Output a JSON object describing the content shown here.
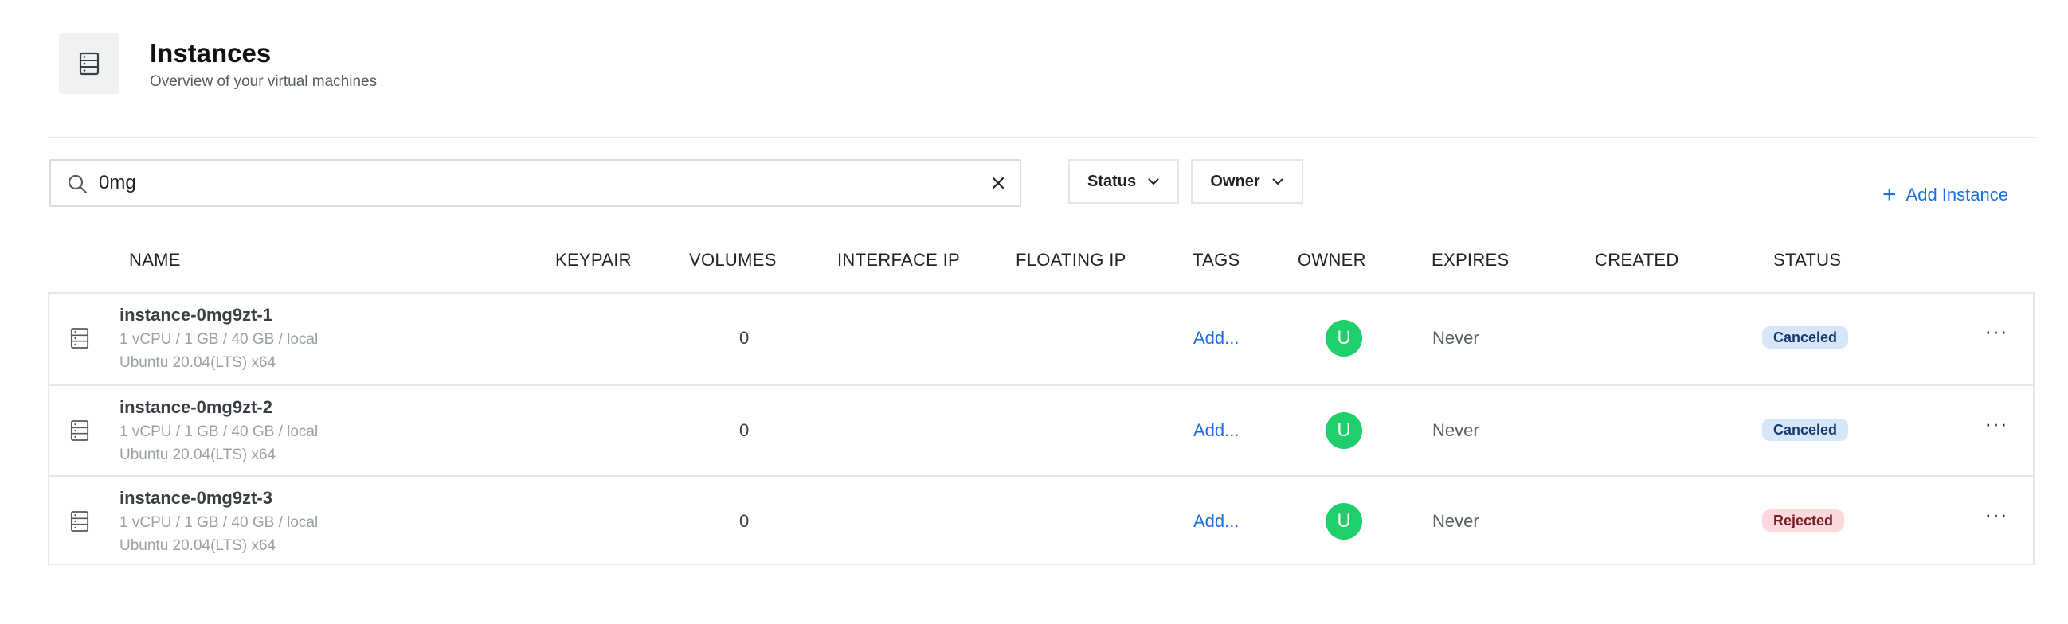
{
  "header": {
    "title": "Instances",
    "subtitle": "Overview of your virtual machines",
    "icon": "server-icon"
  },
  "search": {
    "value": "0mg",
    "placeholder": ""
  },
  "filters": {
    "status_label": "Status",
    "owner_label": "Owner"
  },
  "actions": {
    "add_label": "Add Instance"
  },
  "columns": [
    "NAME",
    "KEYPAIR",
    "VOLUMES",
    "INTERFACE IP",
    "FLOATING IP",
    "TAGS",
    "OWNER",
    "EXPIRES",
    "CREATED",
    "STATUS"
  ],
  "rows": [
    {
      "name": "instance-0mg9zt-1",
      "spec": "1 vCPU / 1 GB / 40 GB / local",
      "os": "Ubuntu 20.04(LTS) x64",
      "volumes": "0",
      "tags": "Add...",
      "owner_initial": "U",
      "expires": "Never",
      "status": "Canceled"
    },
    {
      "name": "instance-0mg9zt-2",
      "spec": "1 vCPU / 1 GB / 40 GB / local",
      "os": "Ubuntu 20.04(LTS) x64",
      "volumes": "0",
      "tags": "Add...",
      "owner_initial": "U",
      "expires": "Never",
      "status": "Canceled"
    },
    {
      "name": "instance-0mg9zt-3",
      "spec": "1 vCPU / 1 GB / 40 GB / local",
      "os": "Ubuntu 20.04(LTS) x64",
      "volumes": "0",
      "tags": "Add...",
      "owner_initial": "U",
      "expires": "Never",
      "status": "Rejected"
    }
  ],
  "colors": {
    "accent": "#1a6fe0",
    "avatar": "#1fcf6b",
    "canceled_bg": "#d6e6fb",
    "rejected_bg": "#fbd9dc"
  }
}
